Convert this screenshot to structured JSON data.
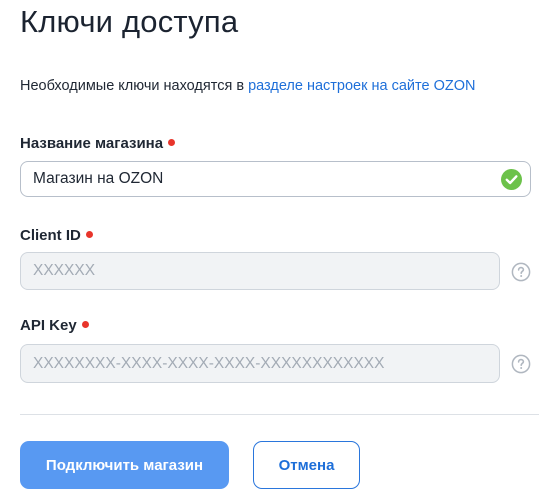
{
  "page": {
    "title": "Ключи доступа",
    "intro_text": "Необходимые ключи находятся в ",
    "intro_link": "разделе настроек на сайте OZON"
  },
  "fields": {
    "store_name": {
      "label": "Название магазина",
      "value": "Магазин на OZON",
      "placeholder": "",
      "status_icon": "check-circle-icon"
    },
    "client_id": {
      "label": "Client ID",
      "value": "",
      "placeholder": "XXXXXX",
      "help_icon": "question-circle-icon"
    },
    "api_key": {
      "label": "API Key",
      "value": "",
      "placeholder": "XXXXXXXX-XXXX-XXXX-XXXX-XXXXXXXXXXXX",
      "help_icon": "question-circle-icon"
    }
  },
  "actions": {
    "connect_label": "Подключить магазин",
    "cancel_label": "Отмена"
  },
  "colors": {
    "accent": "#1e6fd9",
    "primary_button": "#5899f2",
    "required_dot": "#e8352b",
    "success": "#6cc24a"
  }
}
